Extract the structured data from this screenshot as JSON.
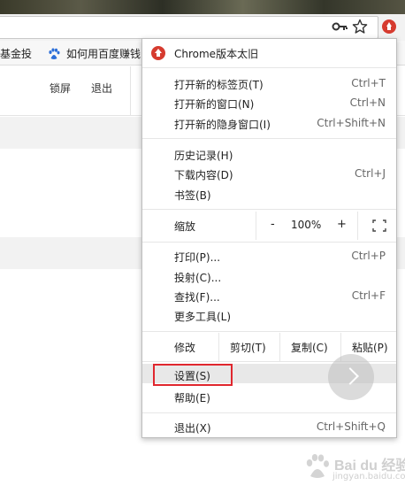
{
  "bookmarks": [
    {
      "label": "基金投"
    },
    {
      "label": "如何用百度赚钱",
      "icon": "baidu-paw-icon"
    }
  ],
  "page": {
    "lock_screen": "锁屏",
    "logout": "退出"
  },
  "menu": {
    "update": {
      "label": "Chrome版本太旧",
      "icon": "update-arrow-icon",
      "color": "#d63b2f"
    },
    "new_tab": {
      "label": "打开新的标签页(T)",
      "shortcut": "Ctrl+T"
    },
    "new_window": {
      "label": "打开新的窗口(N)",
      "shortcut": "Ctrl+N"
    },
    "incognito": {
      "label": "打开新的隐身窗口(I)",
      "shortcut": "Ctrl+Shift+N"
    },
    "history": {
      "label": "历史记录(H)"
    },
    "downloads": {
      "label": "下载内容(D)",
      "shortcut": "Ctrl+J"
    },
    "bookmarks": {
      "label": "书签(B)"
    },
    "zoom": {
      "label": "缩放",
      "minus": "-",
      "value": "100%",
      "plus": "+"
    },
    "print": {
      "label": "打印(P)...",
      "shortcut": "Ctrl+P"
    },
    "cast": {
      "label": "投射(C)..."
    },
    "find": {
      "label": "查找(F)...",
      "shortcut": "Ctrl+F"
    },
    "more_tools": {
      "label": "更多工具(L)"
    },
    "edit": {
      "label": "修改",
      "cut": "剪切(T)",
      "copy": "复制(C)",
      "paste": "粘贴(P)"
    },
    "settings": {
      "label": "设置(S)"
    },
    "help": {
      "label": "帮助(E)"
    },
    "exit": {
      "label": "退出(X)",
      "shortcut": "Ctrl+Shift+Q"
    }
  },
  "highlight_color": "#e0272e",
  "watermark": {
    "text": "Bai du 经验",
    "sub": "jingyan.baidu.com"
  }
}
